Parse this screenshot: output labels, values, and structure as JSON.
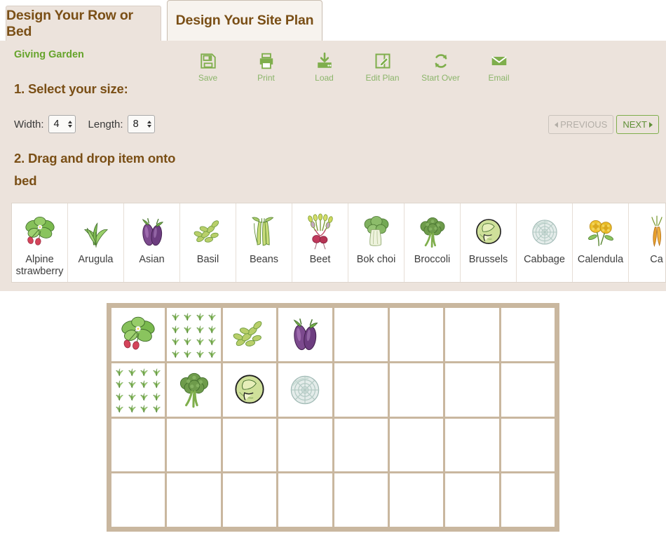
{
  "tabs": [
    {
      "label": "Design Your Row or Bed",
      "active": false
    },
    {
      "label": "Design Your Site Plan",
      "active": true
    }
  ],
  "garden_name": "Giving Garden",
  "toolbar": [
    {
      "label": "Save",
      "icon": "floppy-disk-icon"
    },
    {
      "label": "Print",
      "icon": "printer-icon"
    },
    {
      "label": "Load",
      "icon": "download-tray-icon"
    },
    {
      "label": "Edit Plan",
      "icon": "pencil-square-icon"
    },
    {
      "label": "Start Over",
      "icon": "refresh-cycle-icon"
    },
    {
      "label": "Email",
      "icon": "envelope-icon"
    }
  ],
  "steps": {
    "step1": "1. Select your size:",
    "step2": "2. Drag and drop item onto bed"
  },
  "size": {
    "width_label": "Width:",
    "width_value": "4",
    "length_label": "Length:",
    "length_value": "8"
  },
  "nav": {
    "previous_label": "PREVIOUS",
    "next_label": "NEXT"
  },
  "palette": [
    {
      "label": "Alpine strawberry",
      "art": "strawberry"
    },
    {
      "label": "Arugula",
      "art": "arugula"
    },
    {
      "label": "Asian",
      "art": "eggplant"
    },
    {
      "label": "Basil",
      "art": "basil"
    },
    {
      "label": "Beans",
      "art": "beans"
    },
    {
      "label": "Beet",
      "art": "beet"
    },
    {
      "label": "Bok choi",
      "art": "bokchoi"
    },
    {
      "label": "Broccoli",
      "art": "broccoli"
    },
    {
      "label": "Brussels",
      "art": "brussels"
    },
    {
      "label": "Cabbage",
      "art": "cabbage"
    },
    {
      "label": "Calendula",
      "art": "calendula"
    },
    {
      "label": "Ca",
      "art": "carrot"
    }
  ],
  "grid": {
    "columns": 8,
    "rows": 4,
    "cells": [
      {
        "art": "strawberry",
        "tiled": false
      },
      {
        "art": "arugula",
        "tiled": true
      },
      {
        "art": "basil",
        "tiled": false
      },
      {
        "art": "eggplant",
        "tiled": false
      },
      {
        "art": "",
        "tiled": false
      },
      {
        "art": "",
        "tiled": false
      },
      {
        "art": "",
        "tiled": false
      },
      {
        "art": "",
        "tiled": false
      },
      {
        "art": "arugula",
        "tiled": true
      },
      {
        "art": "broccoli",
        "tiled": false
      },
      {
        "art": "brussels",
        "tiled": false
      },
      {
        "art": "cabbage",
        "tiled": false
      },
      {
        "art": "",
        "tiled": false
      },
      {
        "art": "",
        "tiled": false
      },
      {
        "art": "",
        "tiled": false
      },
      {
        "art": "",
        "tiled": false
      },
      {
        "art": "",
        "tiled": false
      },
      {
        "art": "",
        "tiled": false
      },
      {
        "art": "",
        "tiled": false
      },
      {
        "art": "",
        "tiled": false
      },
      {
        "art": "",
        "tiled": false
      },
      {
        "art": "",
        "tiled": false
      },
      {
        "art": "",
        "tiled": false
      },
      {
        "art": "",
        "tiled": false
      },
      {
        "art": "",
        "tiled": false
      },
      {
        "art": "",
        "tiled": false
      },
      {
        "art": "",
        "tiled": false
      },
      {
        "art": "",
        "tiled": false
      },
      {
        "art": "",
        "tiled": false
      },
      {
        "art": "",
        "tiled": false
      },
      {
        "art": "",
        "tiled": false
      },
      {
        "art": "",
        "tiled": false
      }
    ]
  },
  "colors": {
    "panel_bg": "#ece3dc",
    "tab_text": "#7a4f16",
    "accent_green": "#66a42c",
    "tool_green": "#8bb56a",
    "grid_frame": "#c9b79f",
    "next_border": "#7fae4c",
    "prev_text": "#b3aea7"
  }
}
